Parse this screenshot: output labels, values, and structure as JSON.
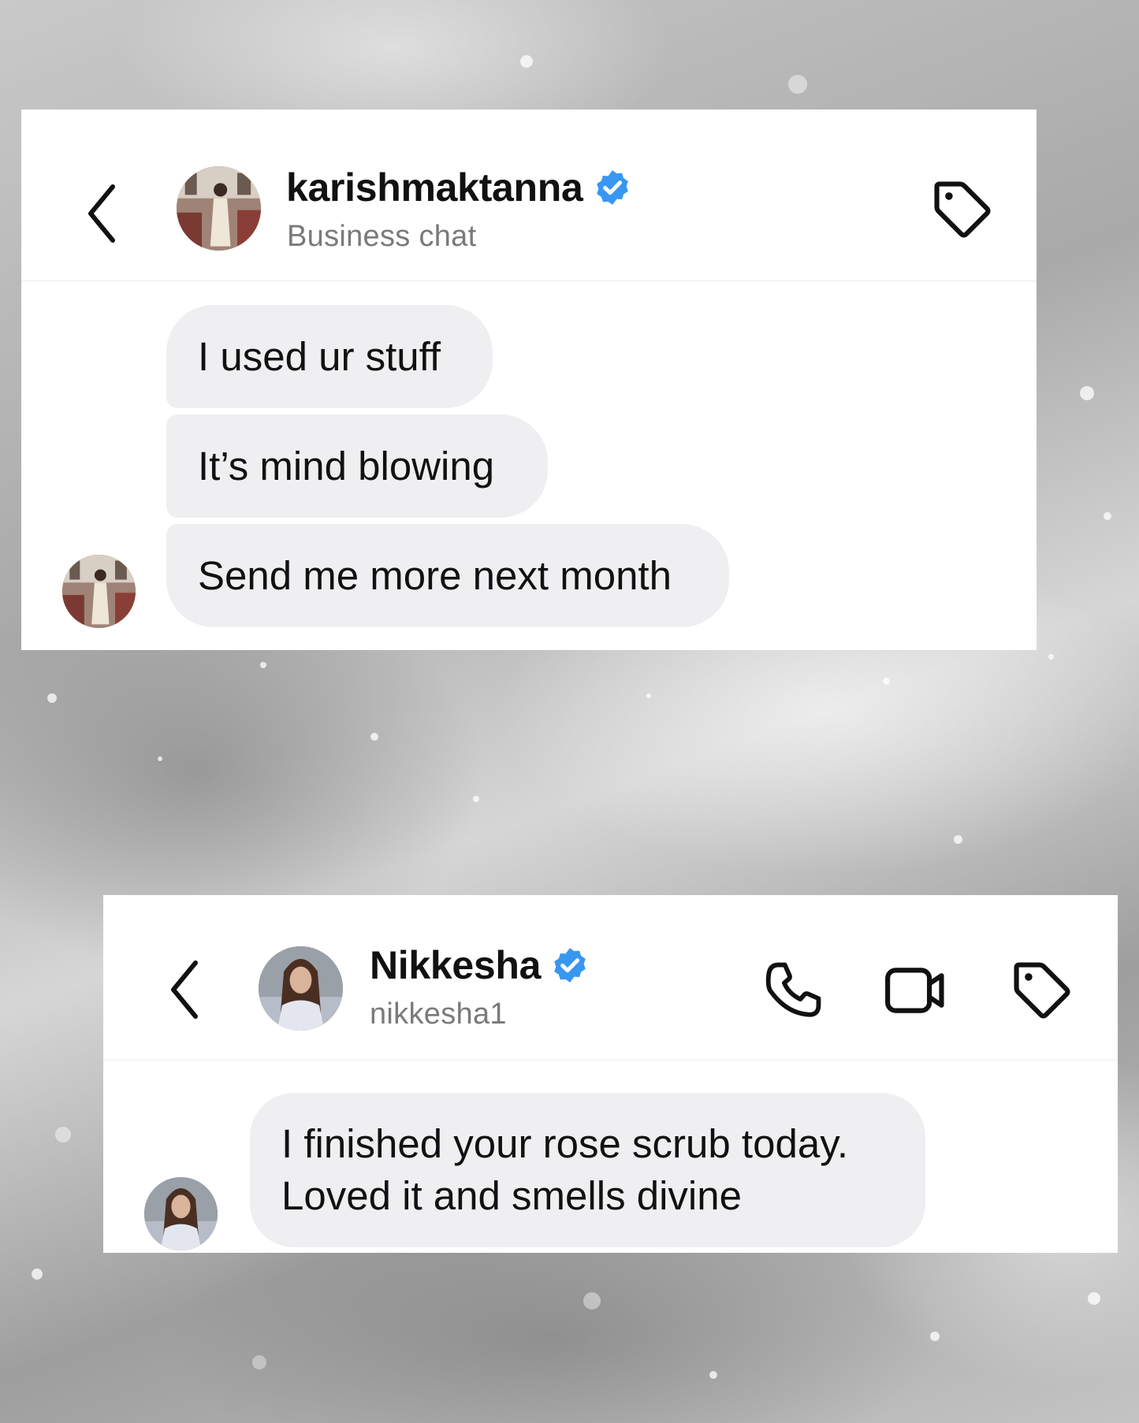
{
  "conversations": [
    {
      "contact": {
        "name": "karishmaktanna",
        "subtitle": "Business chat",
        "verified": true
      },
      "header_icons": [
        "back-chevron-icon",
        "tag-icon"
      ],
      "messages": [
        {
          "text": "I used ur stuff"
        },
        {
          "text": "It’s mind blowing"
        },
        {
          "text": "Send me more next month"
        }
      ]
    },
    {
      "contact": {
        "name": "Nikkesha",
        "subtitle": "nikkesha1",
        "verified": true
      },
      "header_icons": [
        "back-chevron-icon",
        "phone-icon",
        "video-camera-icon",
        "tag-icon"
      ],
      "messages": [
        {
          "text": "I finished your rose scrub today. Loved it and smells divine"
        }
      ]
    }
  ],
  "colors": {
    "verified_badge": "#3897f0",
    "bubble_background": "#efeff1",
    "subtitle_text": "#7a7a7a"
  }
}
